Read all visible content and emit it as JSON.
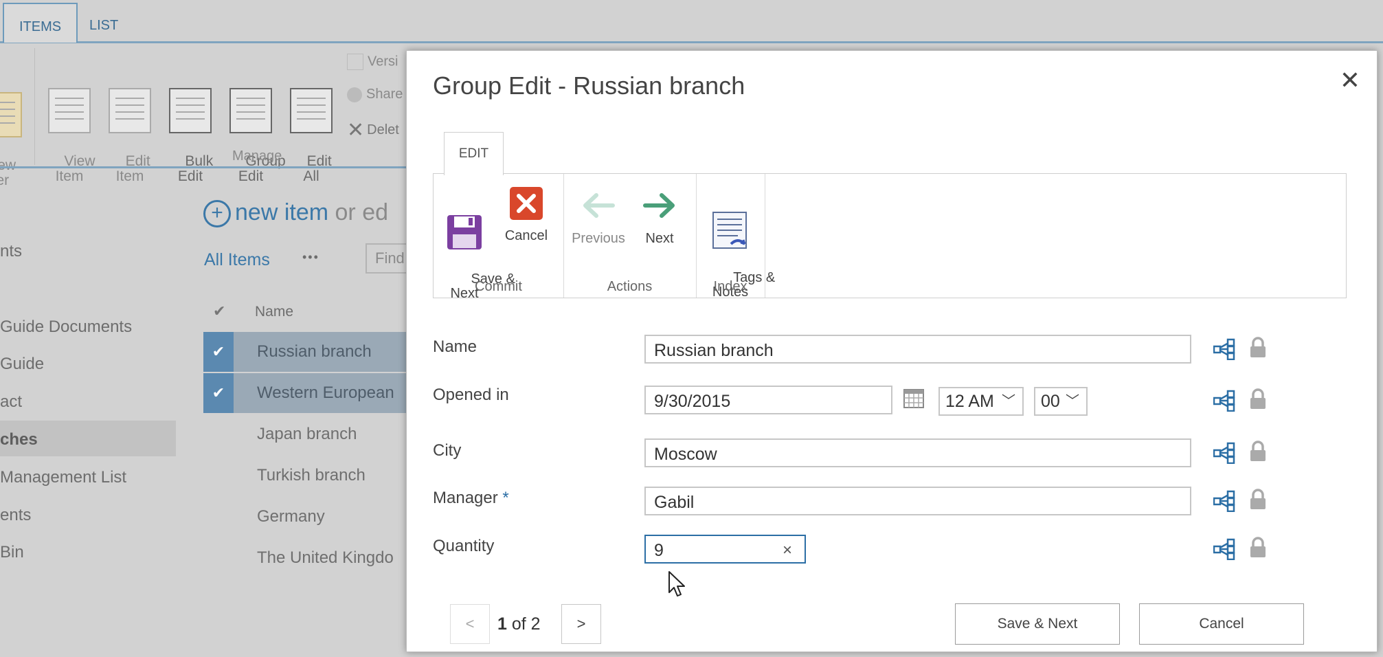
{
  "background": {
    "ribbon_tabs": [
      "ITEMS",
      "LIST"
    ],
    "ribbon_buttons": [
      {
        "label": "ew\nder"
      },
      {
        "label": "View\nItem"
      },
      {
        "label": "Edit\nItem"
      },
      {
        "label": "Bulk\nEdit"
      },
      {
        "label": "Group\nEdit"
      },
      {
        "label": "Edit\nAll"
      }
    ],
    "ribbon_small": [
      "Versi",
      "Share",
      "Delet"
    ],
    "manage_group_label": "Manage",
    "new_item": "new item",
    "new_item_suffix": "or ed",
    "view_label": "All Items",
    "more": "•••",
    "find_placeholder": "Find",
    "list_header": "Name",
    "nav_items": [
      "nts",
      "Guide Documents",
      "Guide",
      "act",
      "ches",
      "Management List",
      "ents",
      "Bin"
    ],
    "rows": [
      {
        "name": "Russian branch",
        "selected": true
      },
      {
        "name": "Western European",
        "selected": true
      },
      {
        "name": "Japan branch",
        "selected": false
      },
      {
        "name": "Turkish branch",
        "selected": false
      },
      {
        "name": "Germany",
        "selected": false
      },
      {
        "name": "The United Kingdo",
        "selected": false
      }
    ]
  },
  "dialog": {
    "title": "Group Edit - Russian branch",
    "close_icon": "close-icon",
    "tab": "EDIT",
    "groups": {
      "commit": {
        "label": "Commit",
        "save_next": "Save &\nNext",
        "cancel": "Cancel"
      },
      "actions": {
        "label": "Actions",
        "previous": "Previous",
        "next": "Next"
      },
      "index": {
        "label": "Index",
        "tags_notes": "Tags &\nNotes"
      }
    },
    "fields": {
      "name": {
        "label": "Name",
        "value": "Russian branch"
      },
      "opened_in": {
        "label": "Opened in",
        "date": "9/30/2015",
        "hour": "12 AM",
        "minute": "00"
      },
      "city": {
        "label": "City",
        "value": "Moscow"
      },
      "manager": {
        "label": "Manager",
        "required_mark": "*",
        "value": "Gabil"
      },
      "quantity": {
        "label": "Quantity",
        "value": "9",
        "clear": "×"
      }
    },
    "pager": {
      "prev": "<",
      "current": "1",
      "of_text": "of 2",
      "next": ">"
    },
    "footer": {
      "save_next": "Save & Next",
      "cancel": "Cancel"
    },
    "colors": {
      "accent": "#2b6ea5",
      "save_purple": "#7b3fa0",
      "cancel_red": "#d9472b",
      "next_green": "#4a9f79"
    }
  }
}
